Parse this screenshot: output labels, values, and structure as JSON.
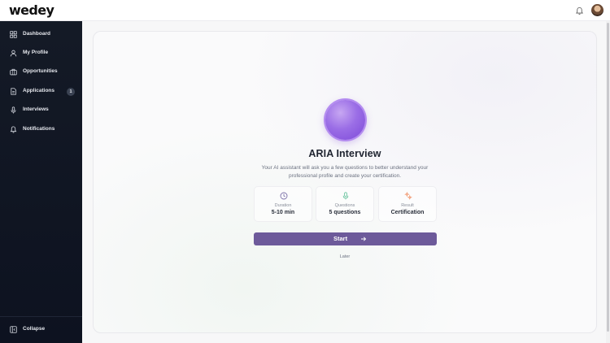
{
  "app": {
    "logo": "wedey"
  },
  "sidebar": {
    "items": [
      {
        "label": "Dashboard",
        "icon": "grid-icon"
      },
      {
        "label": "My Profile",
        "icon": "user-icon"
      },
      {
        "label": "Opportunities",
        "icon": "briefcase-icon"
      },
      {
        "label": "Applications",
        "icon": "document-icon",
        "badge": "1"
      },
      {
        "label": "Interviews",
        "icon": "microphone-icon"
      },
      {
        "label": "Notifications",
        "icon": "bell-icon"
      }
    ],
    "collapse_label": "Collapse"
  },
  "interview": {
    "title": "ARIA Interview",
    "description": "Your AI assistant will ask you a few questions to better understand your professional profile and create your certification.",
    "stats": [
      {
        "label": "Duration",
        "value": "5-10 min",
        "icon": "clock-icon",
        "color": "#7b6fa8"
      },
      {
        "label": "Questions",
        "value": "5 questions",
        "icon": "microphone-icon",
        "color": "#6cc4a0"
      },
      {
        "label": "Result",
        "value": "Certification",
        "icon": "sparkle-icon",
        "color": "#f08a5d"
      }
    ],
    "start_label": "Start",
    "later_label": "Later"
  },
  "colors": {
    "sidebar_bg": "#111725",
    "primary_button": "#6d5a9a",
    "orb": "#8e5be0"
  }
}
